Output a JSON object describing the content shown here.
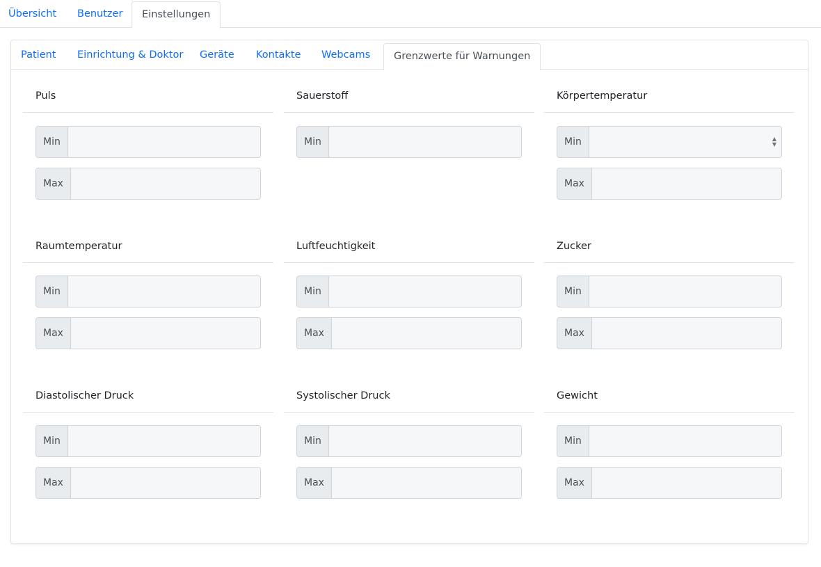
{
  "top_tabs": [
    "Übersicht",
    "Benutzer",
    "Einstellungen"
  ],
  "active_top_tab": "Einstellungen",
  "sub_tabs": [
    "Patient",
    "Einrichtung & Doktor",
    "Geräte",
    "Kontakte",
    "Webcams",
    "Grenzwerte für Warnungen"
  ],
  "active_sub_tab": "Grenzwerte für Warnungen",
  "labels": {
    "min": "Min",
    "max": "Max"
  },
  "groups": [
    {
      "title": "Puls",
      "fields": [
        {
          "label": "Min",
          "value": ""
        },
        {
          "label": "Max",
          "value": ""
        }
      ]
    },
    {
      "title": "Sauerstoff",
      "fields": [
        {
          "label": "Min",
          "value": ""
        }
      ]
    },
    {
      "title": "Körpertemperatur",
      "fields": [
        {
          "label": "Min",
          "value": "",
          "spinner": true
        },
        {
          "label": "Max",
          "value": ""
        }
      ]
    },
    {
      "title": "Raumtemperatur",
      "fields": [
        {
          "label": "Min",
          "value": ""
        },
        {
          "label": "Max",
          "value": ""
        }
      ]
    },
    {
      "title": "Luftfeuchtigkeit",
      "fields": [
        {
          "label": "Min",
          "value": ""
        },
        {
          "label": "Max",
          "value": ""
        }
      ]
    },
    {
      "title": "Zucker",
      "fields": [
        {
          "label": "Min",
          "value": ""
        },
        {
          "label": "Max",
          "value": ""
        }
      ]
    },
    {
      "title": "Diastolischer Druck",
      "fields": [
        {
          "label": "Min",
          "value": ""
        },
        {
          "label": "Max",
          "value": ""
        }
      ]
    },
    {
      "title": "Systolischer Druck",
      "fields": [
        {
          "label": "Min",
          "value": ""
        },
        {
          "label": "Max",
          "value": ""
        }
      ]
    },
    {
      "title": "Gewicht",
      "fields": [
        {
          "label": "Min",
          "value": ""
        },
        {
          "label": "Max",
          "value": ""
        }
      ]
    }
  ],
  "colors": {
    "link": "#0d6efd",
    "border": "#dee2e6",
    "addon_bg": "#e9ecef",
    "input_bg": "#f6f7f9"
  }
}
